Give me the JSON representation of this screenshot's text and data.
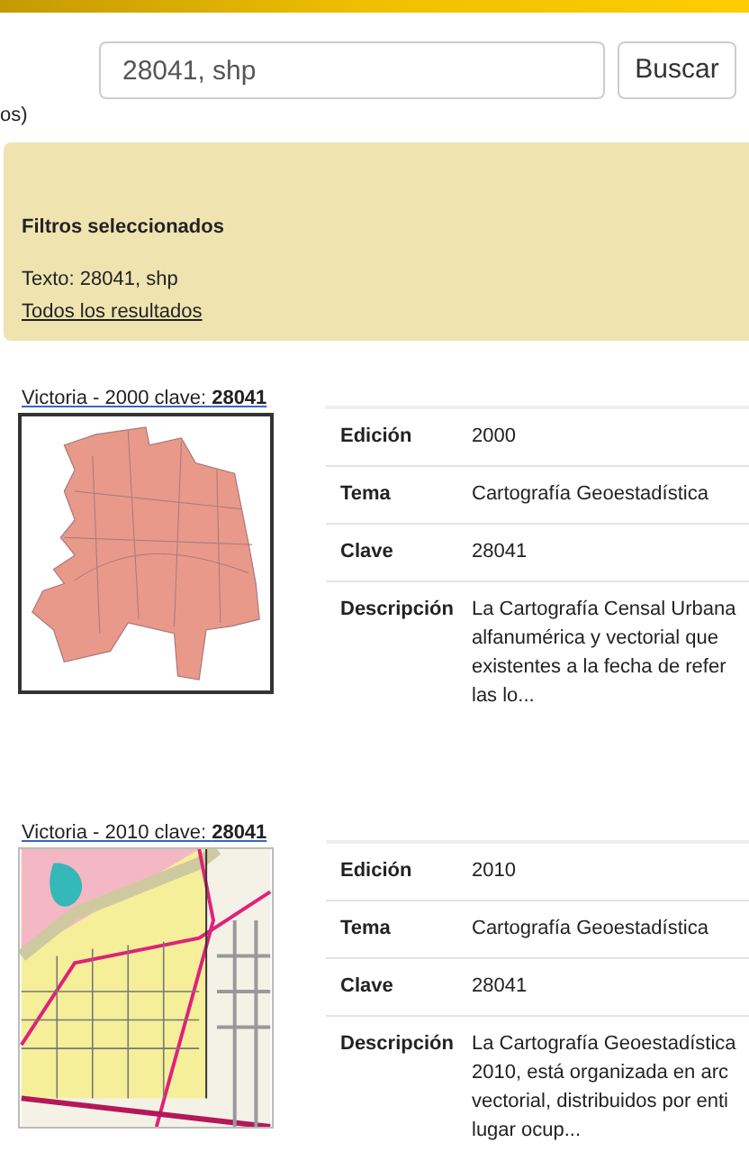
{
  "search": {
    "value": "28041, shp",
    "button": "Buscar"
  },
  "fragment": "os)",
  "filters": {
    "title": "Filtros seleccionados",
    "text": "Texto: 28041, shp",
    "link": "Todos los resultados"
  },
  "results": [
    {
      "title": "Victoria - 2000 clave: **28041**",
      "fields": [
        {
          "label": "Edición",
          "value": "2000"
        },
        {
          "label": "Tema",
          "value": "Cartografía Geoestadística"
        },
        {
          "label": "Clave",
          "value": "28041"
        }
      ],
      "description": {
        "label": "Descripción",
        "lines": [
          "La Cartografía Censal Urbana",
          "alfanumérica y vectorial que",
          "existentes a la fecha de refer",
          "las lo..."
        ]
      }
    },
    {
      "title": "Victoria - 2010 clave: **28041**",
      "fields": [
        {
          "label": "Edición",
          "value": "2010"
        },
        {
          "label": "Tema",
          "value": "Cartografía Geoestadística"
        },
        {
          "label": "Clave",
          "value": "28041"
        }
      ],
      "description": {
        "label": "Descripción",
        "lines": [
          "La Cartografía Geoestadística",
          "2010, está organizada en arc",
          "vectorial, distribuidos por enti",
          "lugar ocup..."
        ]
      }
    }
  ]
}
